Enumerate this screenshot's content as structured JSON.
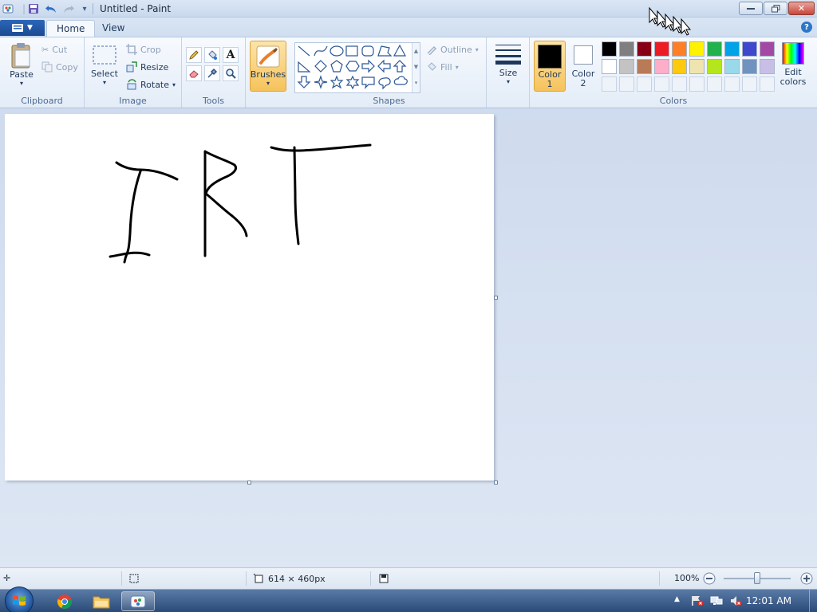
{
  "window": {
    "title": "Untitled - Paint"
  },
  "tabs": {
    "home": "Home",
    "view": "View"
  },
  "clipboard": {
    "label": "Clipboard",
    "paste": "Paste",
    "cut": "Cut",
    "copy": "Copy"
  },
  "image": {
    "label": "Image",
    "select": "Select",
    "crop": "Crop",
    "resize": "Resize",
    "rotate": "Rotate"
  },
  "tools": {
    "label": "Tools"
  },
  "brushes": {
    "label": "Brushes"
  },
  "shapes": {
    "label": "Shapes",
    "outline": "Outline",
    "fill": "Fill"
  },
  "size": {
    "label": "Size"
  },
  "colors": {
    "label": "Colors",
    "color1_line1": "Color",
    "color1_line2": "1",
    "color2_line1": "Color",
    "color2_line2": "2",
    "edit_line1": "Edit",
    "edit_line2": "colors",
    "color1_value": "#000000",
    "color2_value": "#ffffff",
    "palette_row1": [
      "#000000",
      "#7f7f7f",
      "#880015",
      "#ed1c24",
      "#ff7f27",
      "#fff200",
      "#22b14c",
      "#00a2e8",
      "#3f48cc",
      "#a349a4"
    ],
    "palette_row2": [
      "#ffffff",
      "#c3c3c3",
      "#b97a57",
      "#ffaec9",
      "#ffc90e",
      "#efe4b0",
      "#b5e61d",
      "#99d9ea",
      "#7092be",
      "#c8bfe7"
    ]
  },
  "status": {
    "canvas_size": "614 × 460px",
    "zoom": "100%",
    "zoom_fraction": 0.5
  },
  "taskbar": {
    "time": "12:01 AM"
  }
}
